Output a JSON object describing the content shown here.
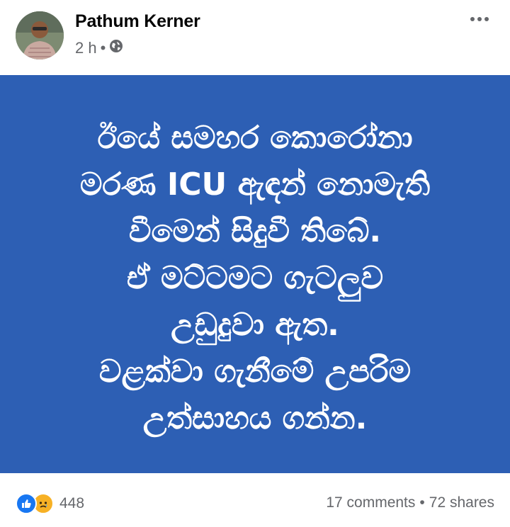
{
  "author": {
    "name": "Pathum Kerner",
    "time": "2 h",
    "separator": "•",
    "privacy_icon": "globe-icon"
  },
  "menu_icon": "more-options-icon",
  "post": {
    "background": "#2d5fb4",
    "lines": [
      "ඊයේ සමහර කොරෝනා",
      "මරණ ICU ඇඳන් නොමැති",
      "වීමෙන් සිදුවී තිබේ.",
      "ඒ මට්ටමට ගැටලුව",
      "උඩුදුවා ඇත.",
      "වළක්වා ගැනීමේ උපරිම",
      "උත්සාහය ගන්න."
    ]
  },
  "footer": {
    "reaction_icons": [
      "like-icon",
      "sad-icon"
    ],
    "reaction_count": "448",
    "comments": "17 comments",
    "dot": "•",
    "shares": "72 shares"
  }
}
